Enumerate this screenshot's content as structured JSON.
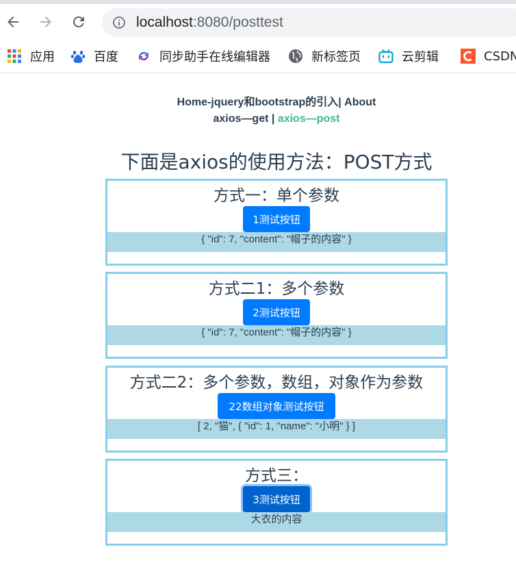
{
  "browser": {
    "url_host": "localhost",
    "url_rest": ":8080/posttest",
    "bookmarks": [
      {
        "label": "应用",
        "icon": "apps-grid-icon"
      },
      {
        "label": "百度",
        "icon": "baidu-paw-icon"
      },
      {
        "label": "同步助手在线编辑器",
        "icon": "sync-icon"
      },
      {
        "label": "新标签页",
        "icon": "globe-icon"
      },
      {
        "label": "云剪辑",
        "icon": "bilibili-tv-icon"
      },
      {
        "label": "CSDN",
        "icon": "csdn-logo-icon"
      }
    ]
  },
  "nav": {
    "row1": {
      "home": "Home-jquery和bootstrap的引入",
      "sep": "|",
      "about": "About"
    },
    "row2": {
      "get": "axios—get",
      "sep": "|",
      "post": "axios—post"
    }
  },
  "main": {
    "heading": "下面是axios的使用方法：POST方式",
    "sections": [
      {
        "title": "方式一：单个参数",
        "button": "1测试按钮",
        "result": "{ \"id\": 7, \"content\": \"帽子的内容\" }"
      },
      {
        "title": "方式二1：多个参数",
        "button": "2测试按钮",
        "result": "{ \"id\": 7, \"content\": \"帽子的内容\" }"
      },
      {
        "title": "方式二2：多个参数，数组，对象作为参数",
        "button": "22数组对象测试按钮",
        "result": "[ 2, \"猫\", { \"id\": 1, \"name\": \"小明\" } ]"
      },
      {
        "title": "方式三：",
        "button": "3测试按钮",
        "result": "大衣的内容"
      }
    ]
  },
  "colors": {
    "link": "#2c3e50",
    "active_link": "#42b983",
    "box_border": "#87ceeb",
    "result_bg": "#add8e6",
    "button": "#007bff"
  }
}
